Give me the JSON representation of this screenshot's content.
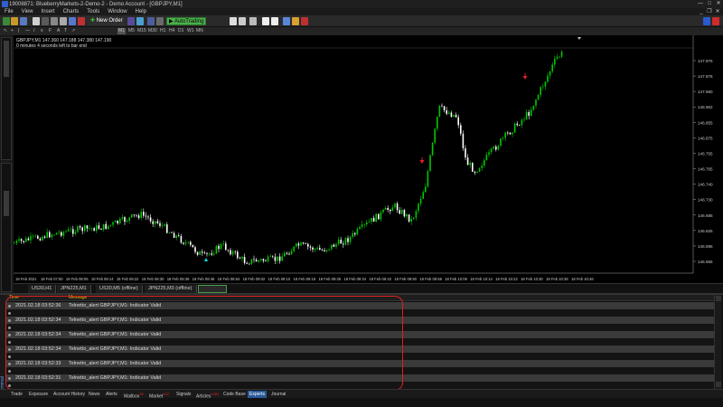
{
  "app": {
    "title": "19008871: BlueberryMarkets-2-Demo-2 - Demo Account - [GBPJPY,M1]"
  },
  "menu": [
    "File",
    "View",
    "Insert",
    "Charts",
    "Tools",
    "Window",
    "Help"
  ],
  "toolbar": {
    "new_order": "New Order",
    "autotrading": "AutoTrading",
    "timeframes": [
      "M1",
      "M5",
      "M15",
      "M30",
      "H1",
      "H4",
      "D1",
      "W1",
      "MN"
    ]
  },
  "chart": {
    "header_line1": "GBPJPY,M1  147.360 147.188 147.380 147.190",
    "header_line2": "0 minutes 4 seconds left to bar end",
    "price_labels": [
      "147.975",
      "147.875",
      "147.560",
      "146.902",
      "146.855",
      "146.875",
      "146.755",
      "146.765",
      "146.740",
      "146.730",
      "146.685",
      "146.625",
      "146.595",
      "146.565"
    ],
    "time_labels": [
      "18 Feb 2021",
      "18 Feb 07:50",
      "18 Feb 08:06",
      "18 Feb 08:14",
      "18 Feb 08:22",
      "18 Feb 08:30",
      "18 Feb 08:38",
      "18 Feb 08:46",
      "18 Feb 08:54",
      "18 Feb 09:02",
      "18 Feb 09:10",
      "18 Feb 09:18",
      "18 Feb 09:26",
      "18 Feb 09:34",
      "18 Feb 09:42",
      "18 Feb 09:50",
      "18 Feb 09:58",
      "18 Feb 10:06",
      "18 Feb 10:14",
      "18 Feb 10:22",
      "18 Feb 10:30",
      "18 Feb 10:38",
      "18 Feb 10:46"
    ],
    "colors": {
      "bull": "#00c800",
      "bear": "#ffffff",
      "arrow": "#e02020",
      "axis": "#aaaaaa"
    }
  },
  "chart_tabs": [
    "US30,H1",
    "JPN225,M1",
    "US30,M5 (offline)",
    "JPN225,M3 (offline)",
    ""
  ],
  "terminal": {
    "columns": {
      "time": "Time",
      "message": "Message"
    },
    "side_label": "Terminal",
    "rows": [
      {
        "time": "2021.02.18 03:52:36",
        "message": "Telnetto_alert GBPJPY,M1:  Indicator Valid"
      },
      {
        "time": "2021.02.18 03:52:34",
        "message": "Telnetto_alert GBPJPY,M1:  Indicator Valid"
      },
      {
        "time": "2021.02.18 03:52:34",
        "message": "Telnetto_alert GBPJPY,M1:  Indicator Valid"
      },
      {
        "time": "2021.02.18 03:52:34",
        "message": "Telnetto_alert GBPJPY,M1:  Indicator Valid"
      },
      {
        "time": "2021.02.18 03:52:33",
        "message": "Telnetto_alert GBPJPY,M1:  Indicator Valid"
      },
      {
        "time": "2021.02.18 03:52:31",
        "message": "Telnetto_alert GBPJPY,M1:  Indicator Valid"
      }
    ]
  },
  "bottom_tabs": [
    {
      "label": "Trade",
      "badge": ""
    },
    {
      "label": "Exposure",
      "badge": ""
    },
    {
      "label": "Account History",
      "badge": ""
    },
    {
      "label": "News",
      "badge": ""
    },
    {
      "label": "Alerts",
      "badge": ""
    },
    {
      "label": "Mailbox",
      "badge": "36"
    },
    {
      "label": "Market",
      "badge": "102"
    },
    {
      "label": "Signals",
      "badge": ""
    },
    {
      "label": "Articles",
      "badge": "1083"
    },
    {
      "label": "Code Base",
      "badge": ""
    },
    {
      "label": "Experts",
      "badge": ""
    },
    {
      "label": "Journal",
      "badge": ""
    }
  ]
}
